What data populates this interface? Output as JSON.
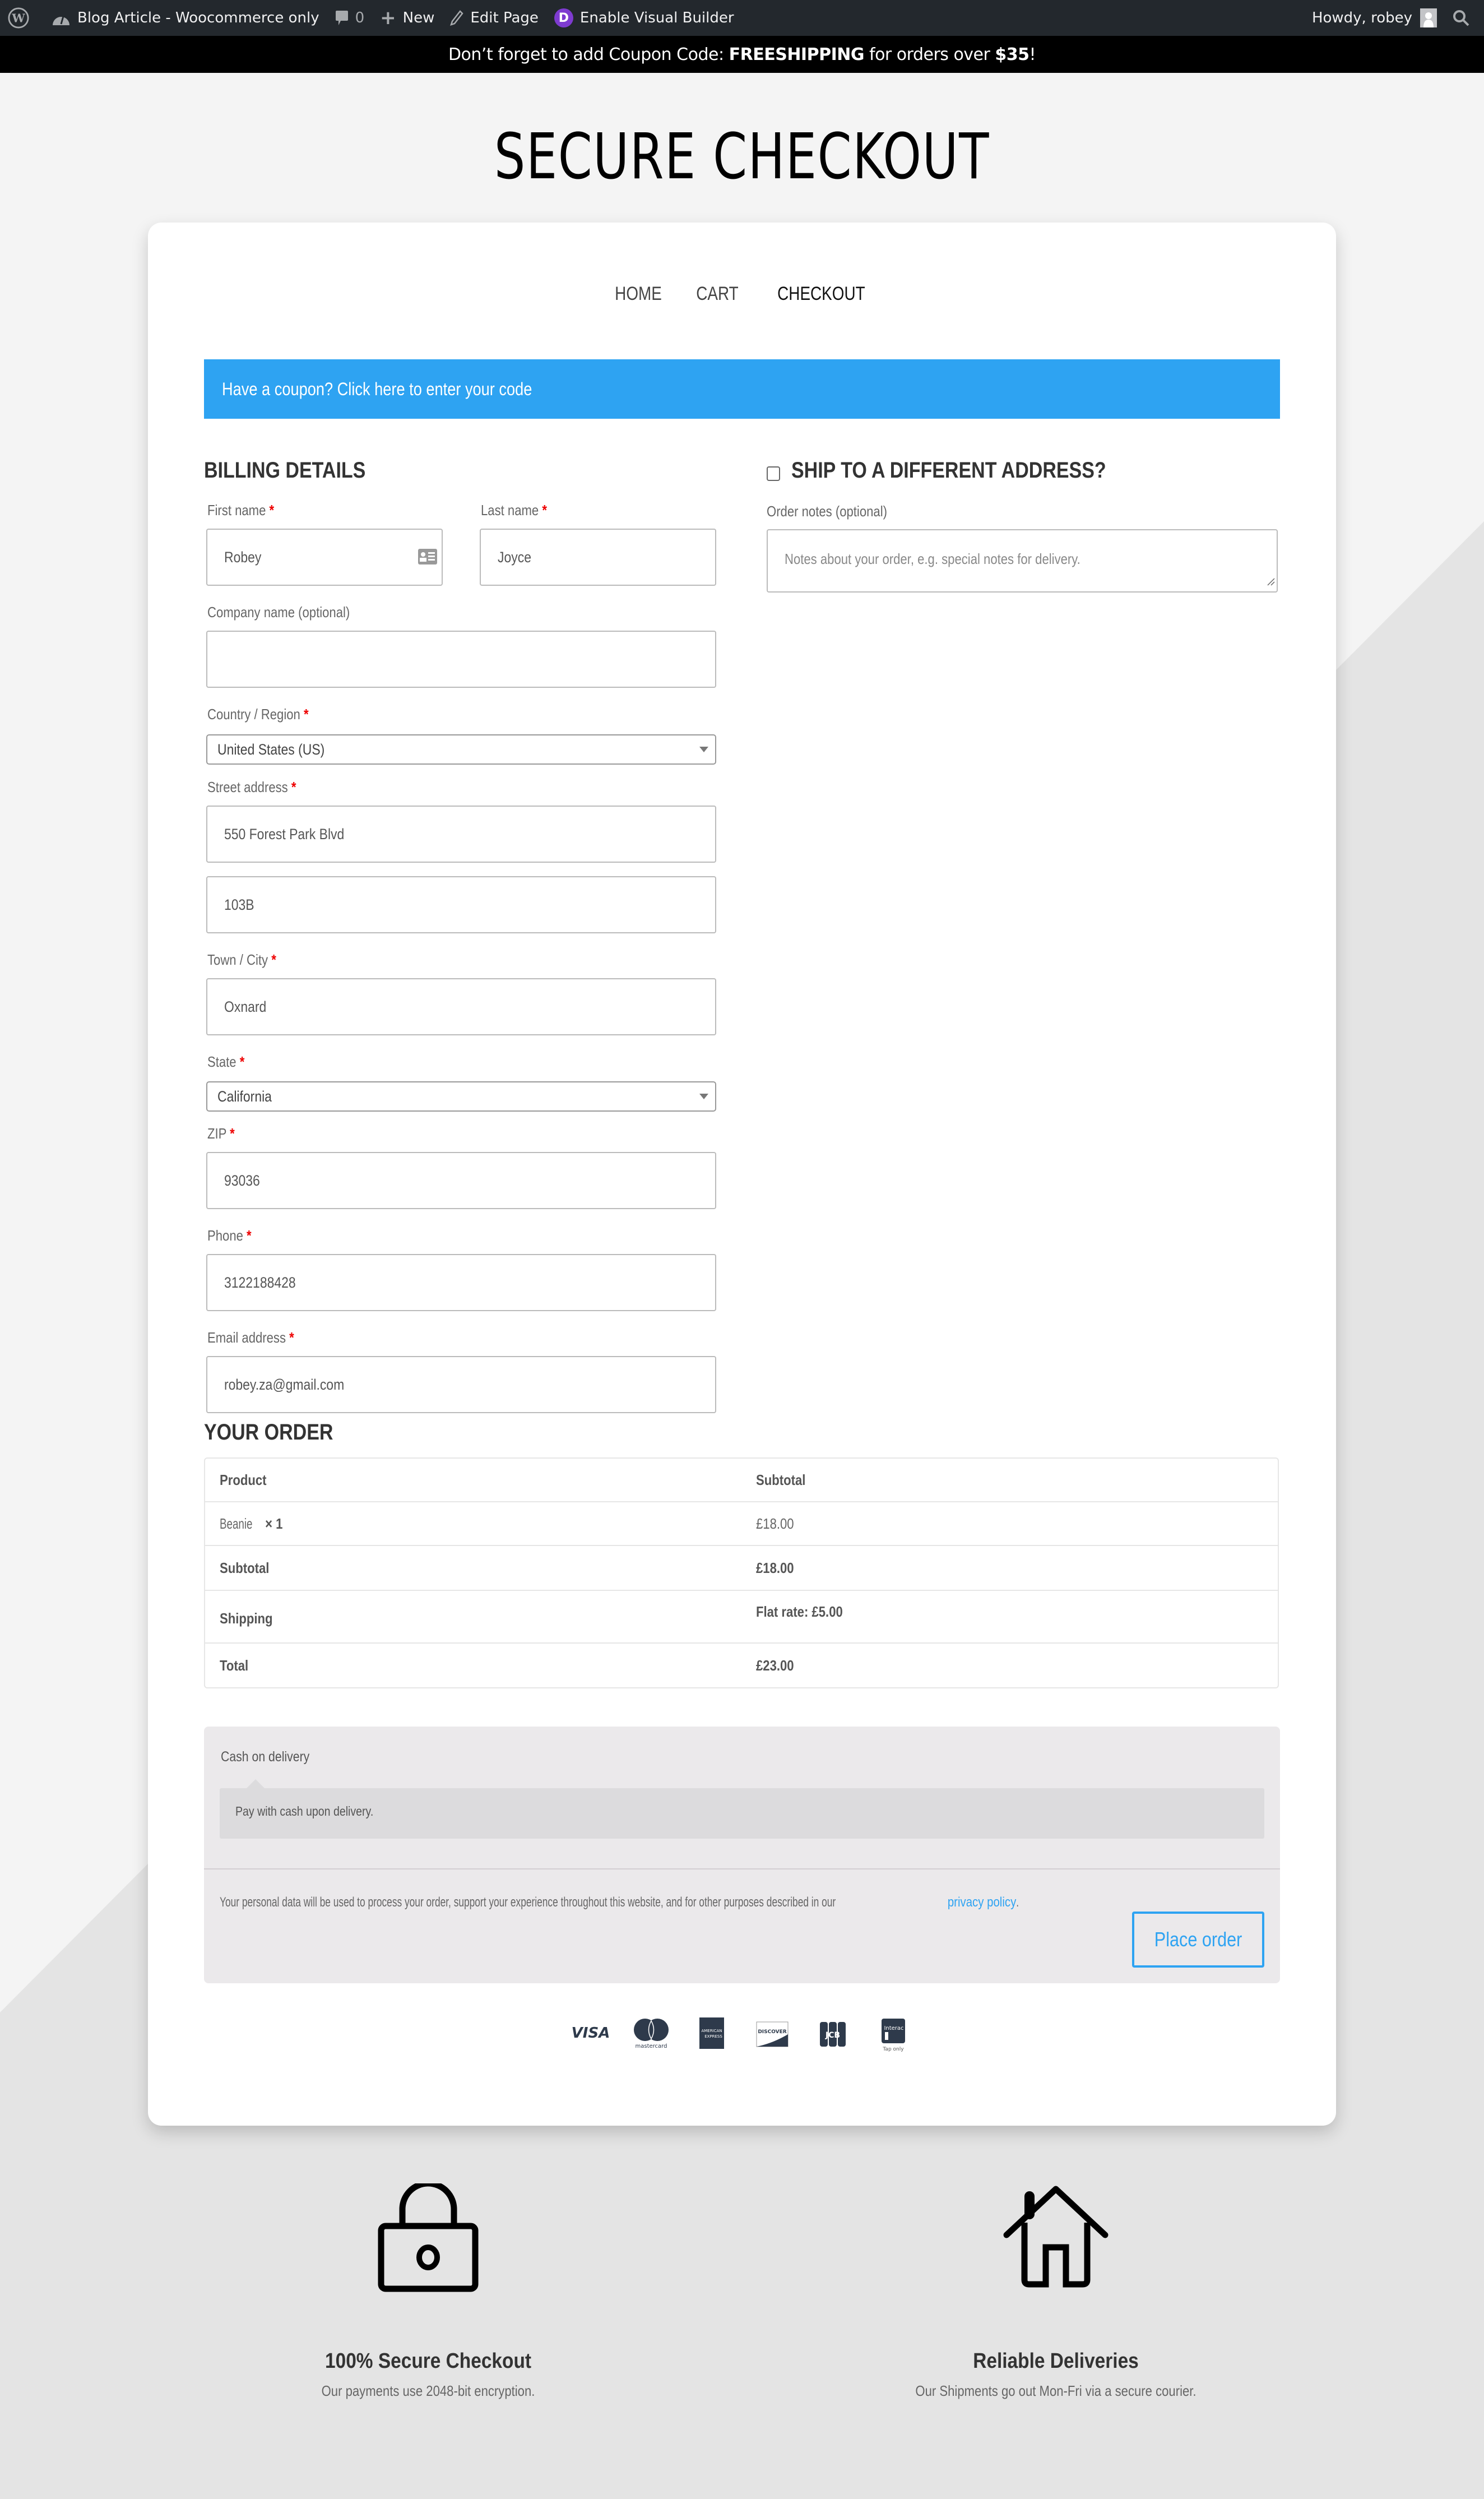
{
  "admin_bar": {
    "site_name": "Blog Article - Woocommerce only",
    "comments_count": "0",
    "new_label": "New",
    "edit_label": "Edit Page",
    "divi_badge": "D",
    "visual_builder_label": "Enable Visual Builder",
    "greeting": "Howdy, robey"
  },
  "promo": {
    "prefix": "Don’t forget to add Coupon Code: ",
    "code": "FREESHIPPING",
    "middle": " for orders over ",
    "amount": "$35",
    "suffix": "!"
  },
  "hero": {
    "title": "SECURE CHECKOUT"
  },
  "nav": {
    "items": [
      {
        "label": "HOME"
      },
      {
        "label": "CART"
      },
      {
        "label": "CHECKOUT"
      }
    ]
  },
  "coupon_notice": "Have a coupon? Click here to enter your code",
  "billing": {
    "heading": "BILLING DETAILS",
    "required_mark": "*",
    "first_name": {
      "label": "First name",
      "value": "Robey"
    },
    "last_name": {
      "label": "Last name",
      "value": "Joyce"
    },
    "company": {
      "label": "Company name (optional)",
      "value": ""
    },
    "country": {
      "label": "Country / Region",
      "value": "United States (US)"
    },
    "street": {
      "label": "Street address",
      "value": "550 Forest Park Blvd",
      "value2": "103B"
    },
    "city": {
      "label": "Town / City",
      "value": "Oxnard"
    },
    "state": {
      "label": "State",
      "value": "California"
    },
    "zip": {
      "label": "ZIP",
      "value": "93036"
    },
    "phone": {
      "label": "Phone",
      "value": "3122188428"
    },
    "email": {
      "label": "Email address",
      "value": "robey.za@gmail.com"
    }
  },
  "shipping": {
    "heading": "SHIP TO A DIFFERENT ADDRESS?",
    "checked": false,
    "notes_label": "Order notes (optional)",
    "notes_placeholder": "Notes about your order, e.g. special notes for delivery."
  },
  "order": {
    "heading": "YOUR ORDER",
    "columns": [
      "Product",
      "Subtotal"
    ],
    "item": {
      "name": "Beanie",
      "qty": "× 1",
      "subtotal": "£18.00"
    },
    "subtotal": {
      "label": "Subtotal",
      "value": "£18.00"
    },
    "shipping": {
      "label": "Shipping",
      "value": "Flat rate: £5.00"
    },
    "total": {
      "label": "Total",
      "value": "£23.00"
    }
  },
  "payment": {
    "method": "Cash on delivery",
    "description": "Pay with cash upon delivery.",
    "privacy_text": "Your personal data will be used to process your order, support your experience throughout this website, and for other purposes described in our ",
    "privacy_link": "privacy policy",
    "privacy_end": ".",
    "place_order": "Place order"
  },
  "card_logos": [
    {
      "name": "VISA"
    },
    {
      "name": "mastercard"
    },
    {
      "name": "AMERICAN EXPRESS"
    },
    {
      "name": "DISCOVER"
    },
    {
      "name": "JCB"
    },
    {
      "name": "Interac",
      "caption": "Tap only"
    }
  ],
  "features": [
    {
      "icon": "lock-icon",
      "title": "100% Secure Checkout",
      "text": "Our payments use 2048-bit encryption."
    },
    {
      "icon": "house-icon",
      "title": "Reliable Deliveries",
      "text": "Our Shipments go out Mon-Fri via a secure courier."
    }
  ],
  "colors": {
    "accent": "#2ea3f2",
    "admin_bar": "#23282d",
    "required": "#e00000",
    "divi": "#7e3bd0"
  }
}
